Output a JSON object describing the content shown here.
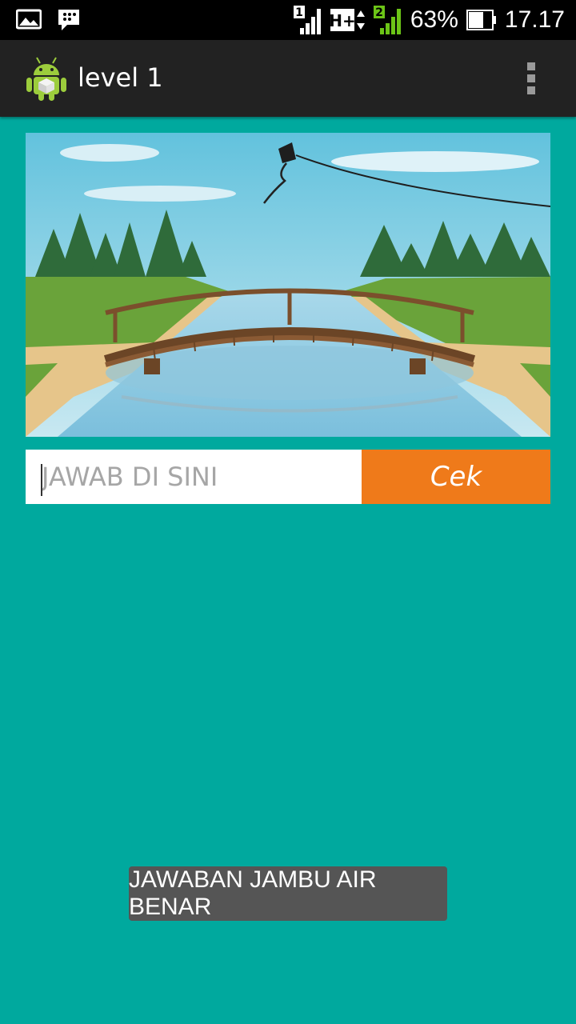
{
  "status_bar": {
    "sim1_label": "1",
    "network_type": "H+",
    "sim2_label": "2",
    "battery_percent": "63%",
    "time": "17.17",
    "left_icons": [
      "gallery-icon",
      "bbm-icon"
    ]
  },
  "action_bar": {
    "title": "level 1",
    "app_icon": "android-icon",
    "menu_icon": "overflow-menu-icon"
  },
  "quiz": {
    "answer_placeholder": "JAWAB DI SINI",
    "answer_value": "",
    "check_button_label": "Cek"
  },
  "toast": {
    "message": "JAWABAN JAMBU AIR BENAR"
  },
  "colors": {
    "background": "#00a99e",
    "action_bar": "#222222",
    "check_button": "#ef7a1a",
    "toast": "#555555"
  }
}
